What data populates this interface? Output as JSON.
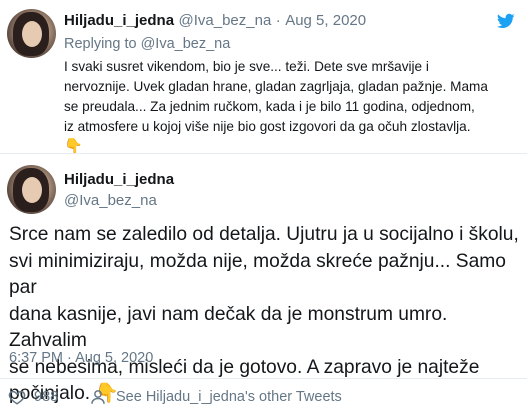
{
  "reply_tweet": {
    "display_name": "Hiljadu_i_jedna",
    "handle": "@Iva_bez_na",
    "separator": "·",
    "date": "Aug 5, 2020",
    "replying_to_prefix": "Replying to",
    "replying_to_handle": "@Iva_bez_na",
    "lines": [
      "I svaki susret vikendom, bio je sve... teži. Dete sve mršavije i",
      "nervoznije. Uvek gladan hrane, gladan zagrljaja, gladan pažnje. Mama",
      "se preudala... Za jednim ručkom, kada i je bilo 11 godina, odjednom,",
      "iz atmosfere u kojoj više nije bio gost izgovori da ga očuh zlostavlja."
    ],
    "emoji": "👇"
  },
  "main_tweet": {
    "display_name": "Hiljadu_i_jedna",
    "handle": "@Iva_bez_na",
    "lines": [
      "Srce nam se zaledilo od detalja. Ujutru ja u socijalno i školu,",
      "svi minimiziraju, možda nije, možda skreće pažnju... Samo par",
      "dana kasnije, javi nam dečak da je monstrum umro. Zahvalim",
      "se nebesima, misleći da je gotovo. A zapravo je najteže",
      "počinjalo."
    ],
    "emoji": "👇",
    "timestamp": "6:37 PM · Aug 5, 2020"
  },
  "footer": {
    "like_count": "988",
    "other_tweets_link": "See Hiljadu_i_jedna's other Tweets"
  },
  "colors": {
    "twitter_blue": "#1da1f2",
    "text": "#14171a",
    "muted": "#657786",
    "divider": "#e6ecf0"
  }
}
